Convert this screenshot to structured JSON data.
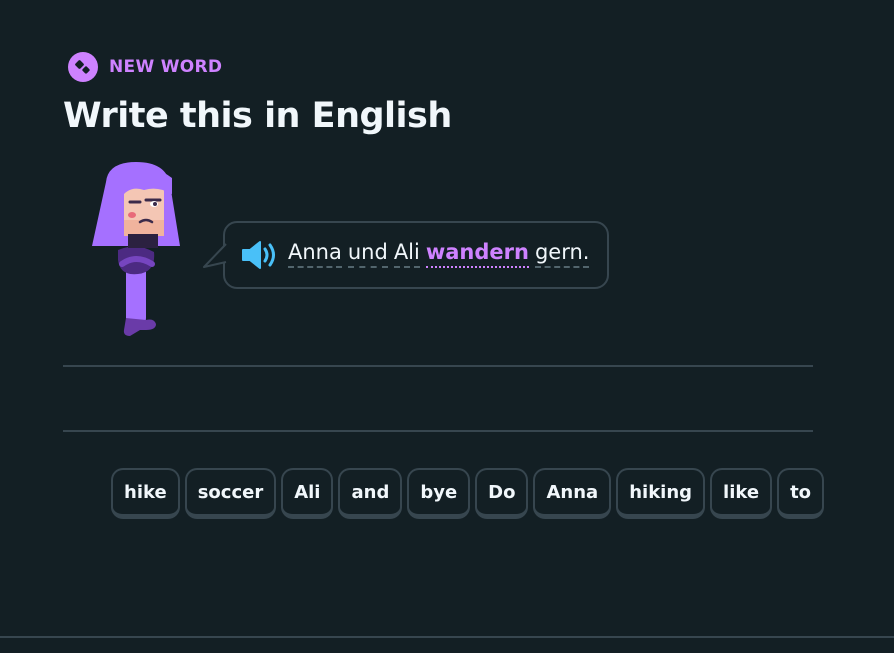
{
  "header": {
    "badge_label": "NEW WORD",
    "title": "Write this in English"
  },
  "prompt": {
    "speaker_icon": "speaker-icon",
    "words": [
      {
        "text": "Anna",
        "highlight": false
      },
      {
        "text": "und",
        "highlight": false
      },
      {
        "text": "Ali",
        "highlight": false
      },
      {
        "text": "wandern",
        "highlight": true
      },
      {
        "text": "gern.",
        "highlight": false
      }
    ]
  },
  "word_bank": [
    "hike",
    "soccer",
    "Ali",
    "and",
    "bye",
    "Do",
    "Anna",
    "hiking",
    "like",
    "to"
  ],
  "colors": {
    "background": "#131f24",
    "accent": "#ce82ff",
    "border": "#37464f",
    "speaker": "#49c0f8",
    "text": "#f1f7fb"
  }
}
